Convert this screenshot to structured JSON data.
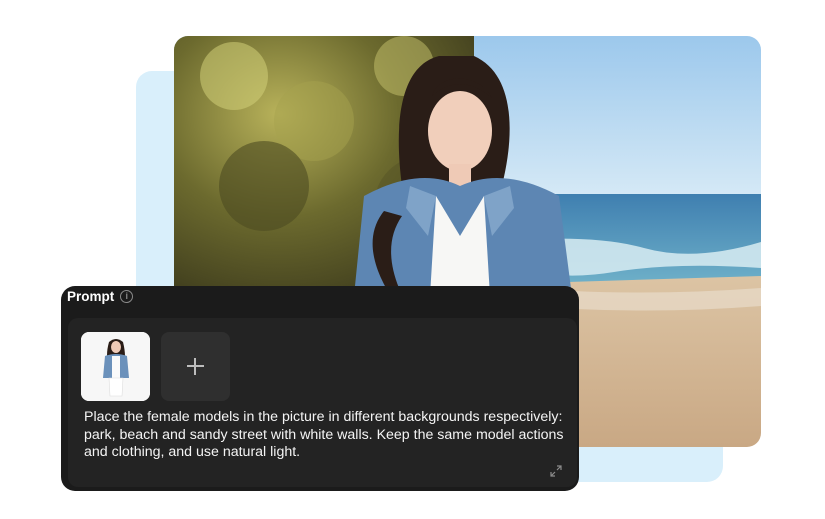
{
  "colors": {
    "backdrop": "#d9effb",
    "panel_bg": "#1b1b1b",
    "panel_inner": "#232323"
  },
  "prompt_panel": {
    "title": "Prompt",
    "info_icon": "info-icon",
    "add_icon": "plus-icon",
    "expand_icon": "expand-icon",
    "text": "Place the female models in the picture in different backgrounds respectively: park, beach and sandy street with white walls. Keep the same model actions and clothing, and use natural light."
  }
}
